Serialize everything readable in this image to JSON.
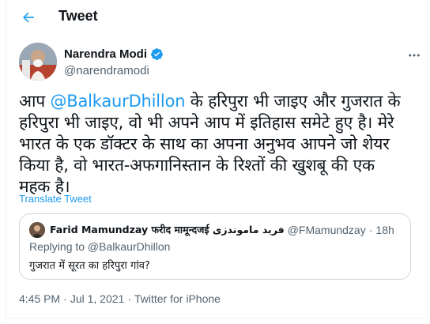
{
  "header": {
    "title": "Tweet"
  },
  "author": {
    "name": "Narendra Modi",
    "handle": "@narendramodi"
  },
  "tweet": {
    "line1_pre": "आप ",
    "mention": "@BalkaurDhillon",
    "line1_post": " के हरिपुरा भी जाइए और गुजरात के",
    "line2": "हरिपुरा भी जाइए, वो भी अपने आप में इतिहास समेटे हुए है। मेरे",
    "line3": "भारत के एक डॉक्टर के साथ का अपना अनुभव आपने जो शेयर",
    "line4": "किया है, वो भारत-अफगानिस्तान के रिश्तों की खुशबू की एक",
    "line5": "महक है।"
  },
  "translate_label": "Translate Tweet",
  "quote": {
    "name": "Farid Mamundzay फरीद मामून्दजई فرید ماموندزی",
    "handle": "@FMamundzay",
    "separator": "·",
    "time": "18h",
    "replying_to": "Replying to @BalkaurDhillon",
    "text": "गुजरात में सूरत का हरिपुरा गांव?"
  },
  "meta": {
    "time": "4:45 PM",
    "dot1": "·",
    "date": "Jul 1, 2021",
    "dot2": "·",
    "source": "Twitter for iPhone"
  },
  "colors": {
    "accent": "#1d9bf0",
    "verified": "#1d9bf0",
    "secondary_text": "#536471"
  },
  "icons": {
    "back": "arrow-left-icon",
    "verified": "verified-badge-icon",
    "more": "more-horizontal-icon"
  }
}
